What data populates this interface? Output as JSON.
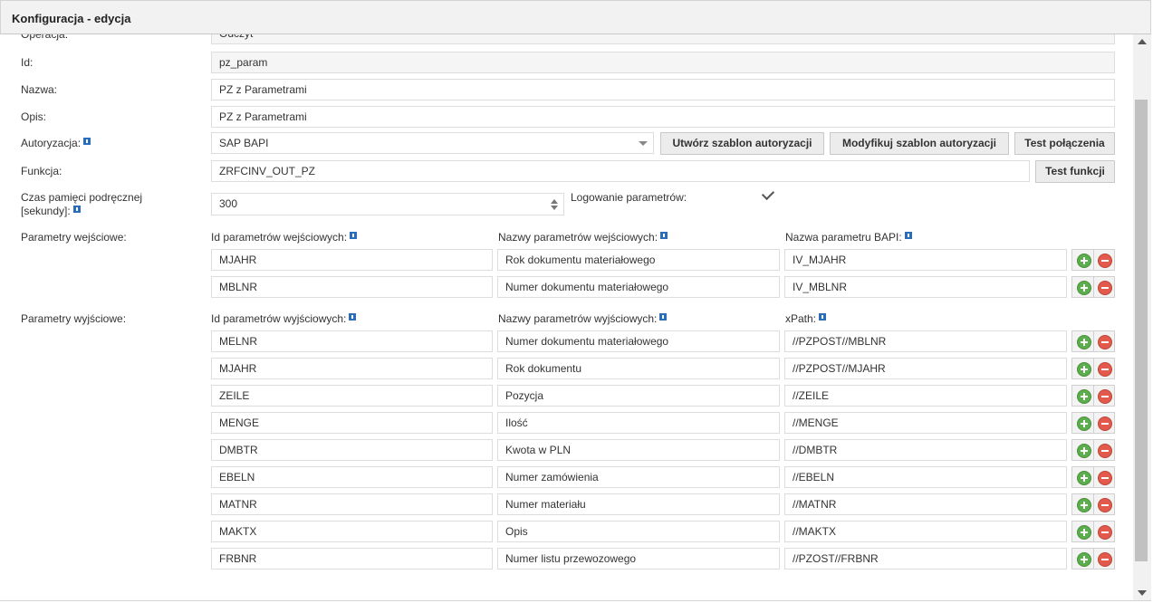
{
  "window": {
    "title": "Konfiguracja - edycja"
  },
  "form": {
    "operacja": {
      "label": "Operacja:",
      "value": "Odczyt"
    },
    "id": {
      "label": "Id:",
      "value": "pz_param"
    },
    "nazwa": {
      "label": "Nazwa:",
      "value": "PZ z Parametrami"
    },
    "opis": {
      "label": "Opis:",
      "value": "PZ z Parametrami"
    },
    "autoryzacja": {
      "label": "Autoryzacja:",
      "value": "SAP BAPI",
      "buttons": {
        "create": "Utwórz szablon autoryzacji",
        "modify": "Modyfikuj szablon autoryzacji",
        "test": "Test połączenia"
      }
    },
    "funkcja": {
      "label": "Funkcja:",
      "value": "ZRFCINV_OUT_PZ",
      "test_button": "Test funkcji"
    },
    "cache": {
      "label_line1": "Czas pamięci podręcznej",
      "label_line2": "[sekundy]:",
      "value": "300"
    },
    "logowanie": {
      "label": "Logowanie parametrów:",
      "checked": true
    }
  },
  "input_params": {
    "label": "Parametry wejściowe:",
    "headers": {
      "id": "Id parametrów wejściowych:",
      "name": "Nazwy parametrów wejściowych:",
      "bapi": "Nazwa parametru BAPI:"
    },
    "rows": [
      {
        "id": "MJAHR",
        "name": "Rok dokumentu materiałowego",
        "bapi": "IV_MJAHR"
      },
      {
        "id": "MBLNR",
        "name": "Numer dokumentu materiałowego",
        "bapi": "IV_MBLNR"
      }
    ]
  },
  "output_params": {
    "label": "Parametry wyjściowe:",
    "headers": {
      "id": "Id parametrów wyjściowych:",
      "name": "Nazwy parametrów wyjściowych:",
      "xpath": "xPath:"
    },
    "rows": [
      {
        "id": "MELNR",
        "name": "Numer dokumentu materiałowego",
        "xpath": "//PZPOST//MBLNR"
      },
      {
        "id": "MJAHR",
        "name": "Rok dokumentu",
        "xpath": "//PZPOST//MJAHR"
      },
      {
        "id": "ZEILE",
        "name": "Pozycja",
        "xpath": "//ZEILE"
      },
      {
        "id": "MENGE",
        "name": "Ilość",
        "xpath": "//MENGE"
      },
      {
        "id": "DMBTR",
        "name": "Kwota w PLN",
        "xpath": "//DMBTR"
      },
      {
        "id": "EBELN",
        "name": "Numer zamówienia",
        "xpath": "//EBELN"
      },
      {
        "id": "MATNR",
        "name": "Numer materiału",
        "xpath": "//MATNR"
      },
      {
        "id": "MAKTX",
        "name": "Opis",
        "xpath": "//MAKTX"
      },
      {
        "id": "FRBNR",
        "name": "Numer listu przewozowego",
        "xpath": "//PZOST//FRBNR"
      }
    ]
  },
  "icons": {
    "info": "info-icon",
    "add": "add-row-icon",
    "remove": "remove-row-icon",
    "check": "checkmark-icon"
  },
  "colors": {
    "info": "#2a6ebb",
    "add": "#5cae4c",
    "remove": "#e35a4d"
  }
}
